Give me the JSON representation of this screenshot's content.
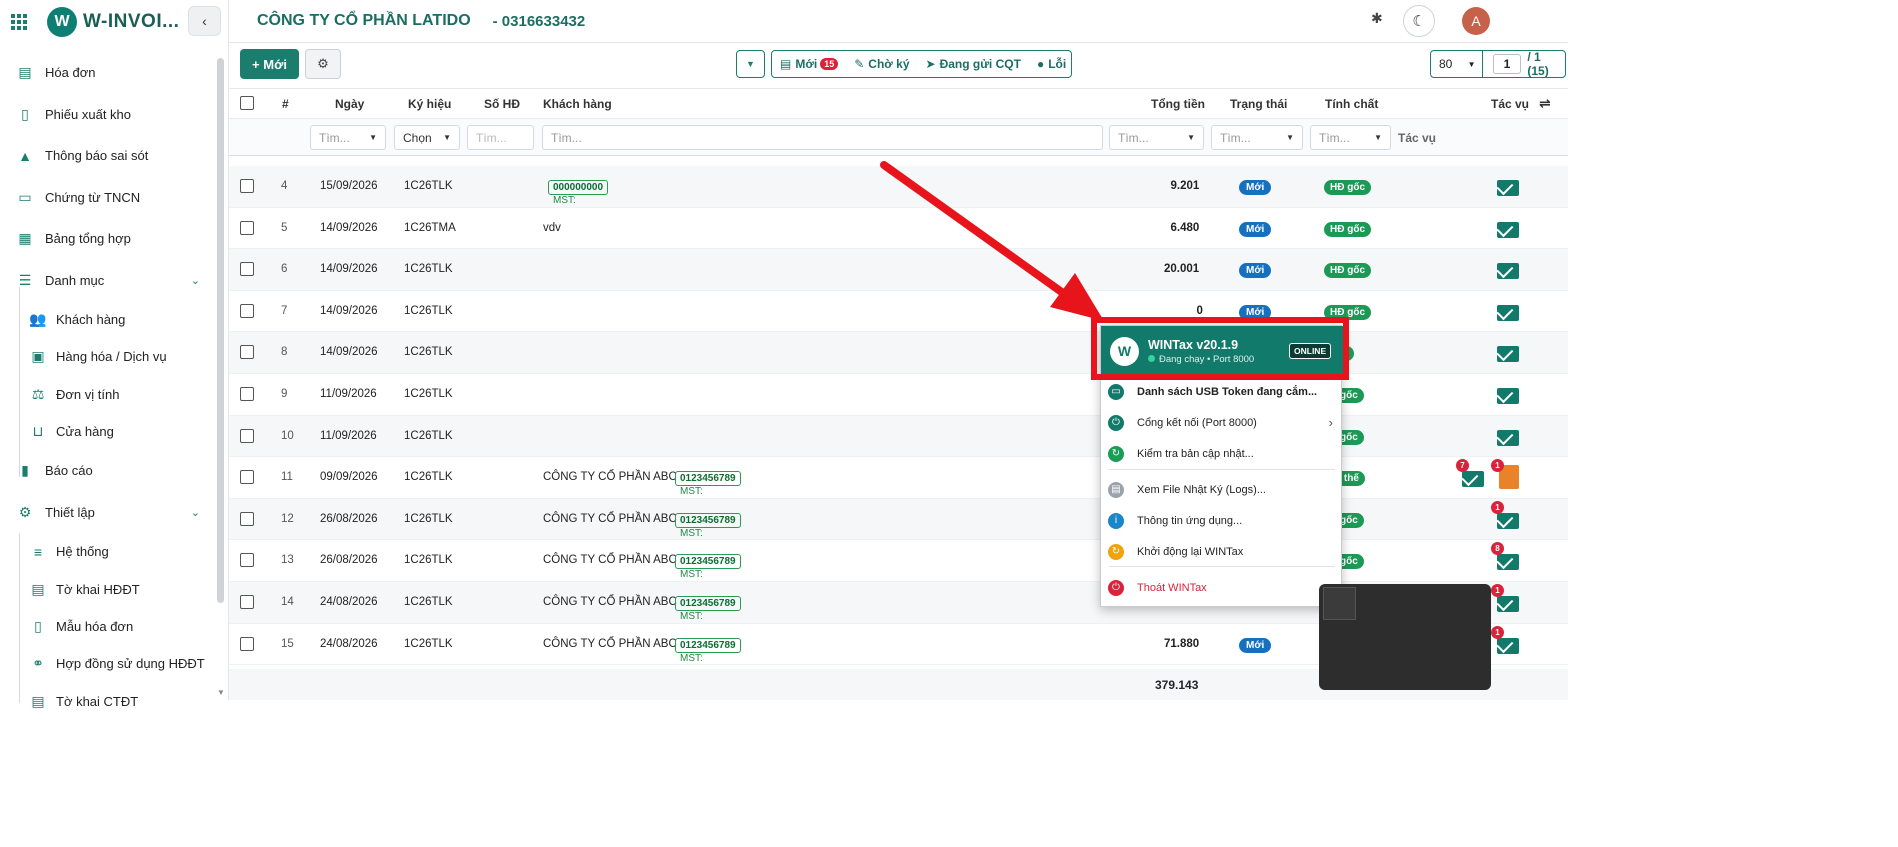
{
  "app": {
    "brand": "W-INVOI...",
    "logo_letter": "W",
    "company": "CÔNG TY CỔ PHẦN LATIDO",
    "phone": "- 0316633432",
    "avatar_letter": "A"
  },
  "sidebar": {
    "items": [
      {
        "label": "Hóa đơn",
        "icon": "file-icon"
      },
      {
        "label": "Phiếu xuất kho",
        "icon": "file-outline-icon"
      },
      {
        "label": "Thông báo sai sót",
        "icon": "warning-icon"
      },
      {
        "label": "Chứng từ TNCN",
        "icon": "id-card-icon"
      },
      {
        "label": "Bảng tổng hợp",
        "icon": "table-icon"
      },
      {
        "label": "Danh mục",
        "icon": "list-icon"
      },
      {
        "label": "Khách hàng",
        "icon": "users-icon"
      },
      {
        "label": "Hàng hóa / Dịch vụ",
        "icon": "boxes-icon"
      },
      {
        "label": "Đơn vị tính",
        "icon": "scale-icon"
      },
      {
        "label": "Cửa hàng",
        "icon": "basket-icon"
      },
      {
        "label": "Báo cáo",
        "icon": "bar-chart-icon"
      },
      {
        "label": "Thiết lập",
        "icon": "gears-icon"
      },
      {
        "label": "Hệ thống",
        "icon": "sliders-icon"
      },
      {
        "label": "Tờ khai HĐĐT",
        "icon": "file-text-icon"
      },
      {
        "label": "Mẫu hóa đơn",
        "icon": "file-template-icon"
      },
      {
        "label": "Hợp đồng sử dụng HĐĐT",
        "icon": "handshake-icon"
      },
      {
        "label": "Tờ khai CTĐT",
        "icon": "file-text-icon"
      }
    ]
  },
  "toolbar": {
    "new_label": "+ Mới",
    "filters": [
      {
        "label": "Mới",
        "count": "15"
      },
      {
        "label": "Chờ ký"
      },
      {
        "label": "Đang gửi CQT"
      },
      {
        "label": "Lỗi"
      }
    ],
    "page_size": "80",
    "page_current": "1",
    "page_total": "/ 1 (15)"
  },
  "table": {
    "headers": [
      "#",
      "Ngày",
      "Ký hiệu",
      "Số HĐ",
      "Khách hàng",
      "Tổng tiền",
      "Trạng thái",
      "Tính chất",
      "Tác vụ"
    ],
    "filters": {
      "search": "Tìm...",
      "choose": "Chọn",
      "actions": "Tác vụ"
    },
    "rows": [
      {
        "no": "4",
        "date": "15/09/2026",
        "sym": "1C26TLK",
        "customer": "",
        "mst": "000000000",
        "total": "9.201",
        "status": "Mới",
        "prop": "HĐ gốc"
      },
      {
        "no": "5",
        "date": "14/09/2026",
        "sym": "1C26TMA",
        "customer": "vdv",
        "mst": "",
        "total": "6.480",
        "status": "Mới",
        "prop": "HĐ gốc"
      },
      {
        "no": "6",
        "date": "14/09/2026",
        "sym": "1C26TLK",
        "customer": "",
        "mst": "",
        "total": "20.001",
        "status": "Mới",
        "prop": "HĐ gốc"
      },
      {
        "no": "7",
        "date": "14/09/2026",
        "sym": "1C26TLK",
        "customer": "",
        "mst": "",
        "total": "0",
        "status": "Mới",
        "prop": "HĐ gốc"
      },
      {
        "no": "8",
        "date": "14/09/2026",
        "sym": "1C26TLK",
        "customer": "",
        "mst": "",
        "total": "",
        "status": "",
        "prop": "gốc"
      },
      {
        "no": "9",
        "date": "11/09/2026",
        "sym": "1C26TLK",
        "customer": "",
        "mst": "",
        "total": "",
        "status": "",
        "prop": "Ð gốc"
      },
      {
        "no": "10",
        "date": "11/09/2026",
        "sym": "1C26TLK",
        "customer": "",
        "mst": "",
        "total": "",
        "status": "",
        "prop": "Ð gốc"
      },
      {
        "no": "11",
        "date": "09/09/2026",
        "sym": "1C26TLK",
        "customer": "CÔNG TY CỔ PHẦN ABC",
        "mst": "0123456789",
        "total": "",
        "status": "",
        "prop": "ay thế"
      },
      {
        "no": "12",
        "date": "26/08/2026",
        "sym": "1C26TLK",
        "customer": "CÔNG TY CỔ PHẦN ABC",
        "mst": "0123456789",
        "total": "",
        "status": "",
        "prop": "Ð gốc"
      },
      {
        "no": "13",
        "date": "26/08/2026",
        "sym": "1C26TLK",
        "customer": "CÔNG TY CỔ PHẦN ABC",
        "mst": "0123456789",
        "total": "",
        "status": "",
        "prop": "Ð gốc"
      },
      {
        "no": "14",
        "date": "24/08/2026",
        "sym": "1C26TLK",
        "customer": "CÔNG TY CỔ PHẦN ABC",
        "mst": "0123456789",
        "total": "",
        "status": "",
        "prop": ""
      },
      {
        "no": "15",
        "date": "24/08/2026",
        "sym": "1C26TLK",
        "customer": "CÔNG TY CỔ PHẦN ABC",
        "mst": "0123456789",
        "total": "71.880",
        "status": "Mới",
        "prop": ""
      }
    ],
    "mst_prefix": "MST:",
    "grand_total": "379.143",
    "badges": {
      "row11_mail": "7",
      "row11_doc": "1",
      "row12_mail": "1",
      "row13_mail": "8",
      "row14_mail": "1",
      "row15_mail": "1"
    }
  },
  "wintax": {
    "logo_letter": "W",
    "title": "WINTax v20.1.9",
    "subtitle": "Đang chạy • Port 8000",
    "status": "ONLINE",
    "items": [
      {
        "label": "Danh sách USB Token đang cắm...",
        "icon": "usb-icon",
        "color": "#127a6a"
      },
      {
        "label": "Cổng kết nối (Port 8000)",
        "icon": "plug-icon",
        "color": "#127a6a"
      },
      {
        "label": "Kiểm tra bản cập nhật...",
        "icon": "refresh-icon",
        "color": "#1a9d55"
      },
      {
        "label": "Xem File Nhật Ký (Logs)...",
        "icon": "log-file-icon",
        "color": "#9aa3ab"
      },
      {
        "label": "Thông tin ứng dụng...",
        "icon": "info-icon",
        "color": "#1b86c9"
      },
      {
        "label": "Khởi động lại WINTax",
        "icon": "restart-icon",
        "color": "#f0a30a"
      },
      {
        "label": "Thoát WINTax",
        "icon": "power-icon",
        "color": "#d9233a"
      }
    ]
  },
  "colors": {
    "primary": "#1a7d6e",
    "status_new": "#1570c0",
    "prop_original": "#1b9a56",
    "highlight": "#e8141c",
    "badge": "#d9233a"
  }
}
